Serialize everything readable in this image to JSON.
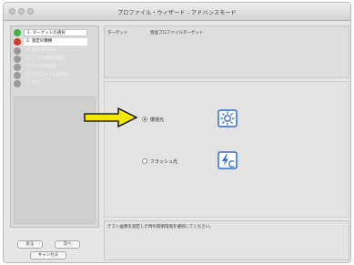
{
  "window": {
    "title": "プロファイル・ウィザード - アドバンスモード"
  },
  "steps": [
    {
      "label": "1. ターゲットの選択",
      "state": "done",
      "color": "#3fb24a"
    },
    {
      "label": "2. 測定の種類",
      "state": "active",
      "color": "#d83a2c"
    },
    {
      "label": "3. 測定器の設定",
      "state": "todo",
      "color": "#9a9a9a"
    },
    {
      "label": "4. テスト画像の選択",
      "state": "todo",
      "color": "#9a9a9a"
    },
    {
      "label": "5. データの取得",
      "state": "todo",
      "color": "#9a9a9a"
    },
    {
      "label": "6. プロファイルの作成",
      "state": "todo",
      "color": "#9a9a9a"
    },
    {
      "label": "7. 完了",
      "state": "todo",
      "color": "#9a9a9a"
    }
  ],
  "nav": {
    "back": "戻る",
    "next": "次へ",
    "cancel": "キャンセル"
  },
  "header": {
    "col1": "ターゲット",
    "col2": "液晶プロファイルターゲット"
  },
  "options": {
    "ambient": {
      "label": "環境光",
      "checked": true,
      "icon": "ambient-light-icon"
    },
    "flash": {
      "label": "フラッシュ光",
      "checked": false,
      "icon": "flash-icon"
    }
  },
  "message": "テスト画像を測定した時の照明環境を選択してください。",
  "colors": {
    "accent": "#2e6ec2",
    "arrow": "#f5e600"
  }
}
